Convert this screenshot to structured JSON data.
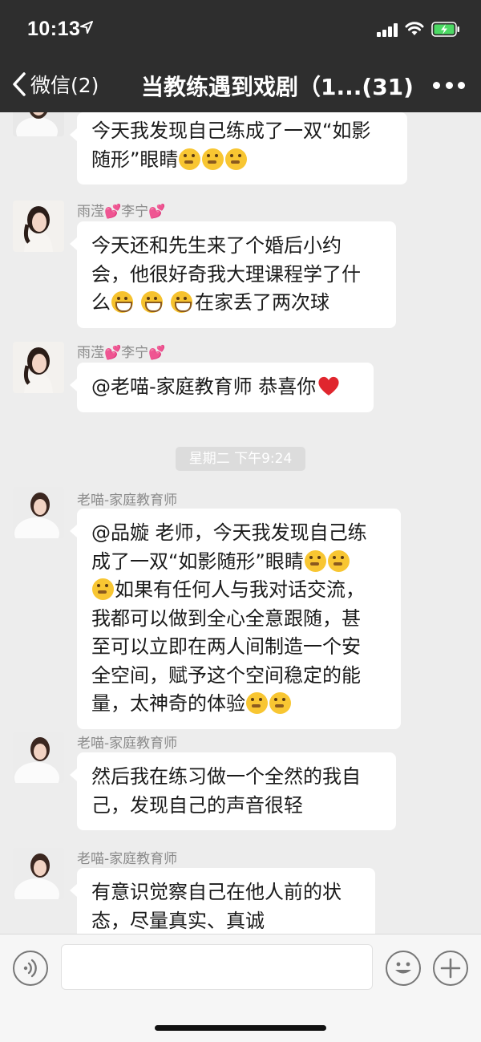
{
  "status_bar": {
    "time": "10:13"
  },
  "nav": {
    "back_label": "微信(2)",
    "title": "当教练遇到戏剧（1...(31)"
  },
  "messages": [
    {
      "sender": "",
      "lines": [
        "今天我发现自己练成了一双“如影",
        "随形”眼睛"
      ],
      "emojis": [
        "thinking-face",
        "thinking-face",
        "thinking-face"
      ]
    },
    {
      "sender_name": "雨滢",
      "sender_name2": "李宁",
      "lines": [
        "今天还和先生来了个婚后小约",
        "会，他很好奇我大理课程学了什",
        "么",
        "在家丢了两次球"
      ],
      "emojis": [
        "grinning-face",
        "grinning-face",
        "grinning-face"
      ]
    },
    {
      "sender_name": "雨滢",
      "sender_name2": "李宁",
      "lines": [
        "@老喵-家庭教育师 恭喜你"
      ],
      "emojis": [
        "red-heart"
      ]
    },
    {
      "sender": "老喵-家庭教育师",
      "lines": [
        "@品嫙 老师，今天我发现自己练",
        "成了一双“如影随形”眼睛",
        "如果有任何人与我对话交流，",
        "我都可以做到全心全意跟随，甚",
        "至可以立即在两人间制造一个安",
        "全空间，赋予这个空间稳定的能",
        "量，太神奇的体验"
      ],
      "emojis": [
        "thinking-face",
        "thinking-face",
        "thinking-face",
        "thinking-face",
        "thinking-face"
      ]
    },
    {
      "sender": "老喵-家庭教育师",
      "lines": [
        "然后我在练习做一个全然的我自",
        "己，发现自己的声音很轻"
      ]
    },
    {
      "sender": "老喵-家庭教育师",
      "lines": [
        "有意识觉察自己在他人前的状",
        "态，尽量真实、真诚"
      ]
    }
  ],
  "timestamp": "星期二 下午9:24",
  "input": {
    "value": ""
  },
  "colors": {
    "bar": "#2e2e2e",
    "background": "#ededed",
    "bubble": "#ffffff"
  }
}
